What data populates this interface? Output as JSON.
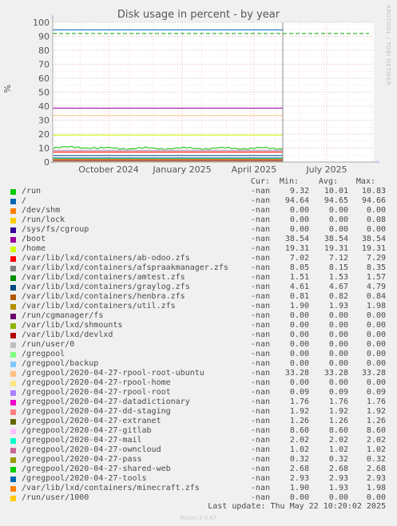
{
  "chart_data": {
    "type": "line",
    "title": "Disk usage in percent - by year",
    "ylabel": "%",
    "ylim": [
      0,
      100
    ],
    "y_ticks": [
      0,
      10,
      20,
      30,
      40,
      50,
      60,
      70,
      80,
      90,
      100
    ],
    "x_ticks": [
      "October 2024",
      "January 2025",
      "April 2025",
      "July 2025"
    ],
    "warning_threshold": 92,
    "grid": true,
    "columns": [
      "Cur:",
      "Min:",
      "Avg:",
      "Max:"
    ],
    "series": [
      {
        "name": "/run",
        "color": "#00cc00",
        "cur": "-nan",
        "min": "9.32",
        "avg": "10.01",
        "max": "10.83"
      },
      {
        "name": "/",
        "color": "#0066b3",
        "cur": "-nan",
        "min": "94.64",
        "avg": "94.65",
        "max": "94.66"
      },
      {
        "name": "/dev/shm",
        "color": "#ff8000",
        "cur": "-nan",
        "min": "0.00",
        "avg": "0.00",
        "max": "0.00"
      },
      {
        "name": "/run/lock",
        "color": "#ffcc00",
        "cur": "-nan",
        "min": "0.00",
        "avg": "0.00",
        "max": "0.08"
      },
      {
        "name": "/sys/fs/cgroup",
        "color": "#330099",
        "cur": "-nan",
        "min": "0.00",
        "avg": "0.00",
        "max": "0.00"
      },
      {
        "name": "/boot",
        "color": "#990099",
        "cur": "-nan",
        "min": "38.54",
        "avg": "38.54",
        "max": "38.54"
      },
      {
        "name": "/home",
        "color": "#ccff00",
        "cur": "-nan",
        "min": "19.31",
        "avg": "19.31",
        "max": "19.31"
      },
      {
        "name": "/var/lib/lxd/containers/ab-odoo.zfs",
        "color": "#ff0000",
        "cur": "-nan",
        "min": "7.02",
        "avg": "7.12",
        "max": "7.29"
      },
      {
        "name": "/var/lib/lxd/containers/afspraakmanager.zfs",
        "color": "#808080",
        "cur": "-nan",
        "min": "8.05",
        "avg": "8.15",
        "max": "8.35"
      },
      {
        "name": "/var/lib/lxd/containers/amtest.zfs",
        "color": "#008f00",
        "cur": "-nan",
        "min": "1.51",
        "avg": "1.53",
        "max": "1.57"
      },
      {
        "name": "/var/lib/lxd/containers/graylog.zfs",
        "color": "#00487d",
        "cur": "-nan",
        "min": "4.61",
        "avg": "4.67",
        "max": "4.79"
      },
      {
        "name": "/var/lib/lxd/containers/henbra.zfs",
        "color": "#b35a00",
        "cur": "-nan",
        "min": "0.81",
        "avg": "0.82",
        "max": "0.84"
      },
      {
        "name": "/var/lib/lxd/containers/util.zfs",
        "color": "#b38f00",
        "cur": "-nan",
        "min": "1.90",
        "avg": "1.93",
        "max": "1.98"
      },
      {
        "name": "/run/cgmanager/fs",
        "color": "#6b006b",
        "cur": "-nan",
        "min": "0.00",
        "avg": "0.00",
        "max": "0.00"
      },
      {
        "name": "/var/lib/lxd/shmounts",
        "color": "#8fb300",
        "cur": "-nan",
        "min": "0.00",
        "avg": "0.00",
        "max": "0.00"
      },
      {
        "name": "/var/lib/lxd/devlxd",
        "color": "#b30000",
        "cur": "-nan",
        "min": "0.00",
        "avg": "0.00",
        "max": "0.00"
      },
      {
        "name": "/run/user/0",
        "color": "#bebebe",
        "cur": "-nan",
        "min": "0.00",
        "avg": "0.00",
        "max": "0.00"
      },
      {
        "name": "/gregpool",
        "color": "#80ff80",
        "cur": "-nan",
        "min": "0.00",
        "avg": "0.00",
        "max": "0.00"
      },
      {
        "name": "/gregpool/backup",
        "color": "#80c9ff",
        "cur": "-nan",
        "min": "0.00",
        "avg": "0.00",
        "max": "0.00"
      },
      {
        "name": "/gregpool/2020-04-27-rpool-root-ubuntu",
        "color": "#ffc080",
        "cur": "-nan",
        "min": "33.28",
        "avg": "33.28",
        "max": "33.28"
      },
      {
        "name": "/gregpool/2020-04-27-rpool-home",
        "color": "#ffe680",
        "cur": "-nan",
        "min": "0.00",
        "avg": "0.00",
        "max": "0.00"
      },
      {
        "name": "/gregpool/2020-04-27-rpool-root",
        "color": "#aa80ff",
        "cur": "-nan",
        "min": "0.09",
        "avg": "0.09",
        "max": "0.09"
      },
      {
        "name": "/gregpool/2020-04-27-datadictionary",
        "color": "#ee00cc",
        "cur": "-nan",
        "min": "1.76",
        "avg": "1.76",
        "max": "1.76"
      },
      {
        "name": "/gregpool/2020-04-27-dd-staging",
        "color": "#ff8080",
        "cur": "-nan",
        "min": "1.92",
        "avg": "1.92",
        "max": "1.92"
      },
      {
        "name": "/gregpool/2020-04-27-extranet",
        "color": "#666600",
        "cur": "-nan",
        "min": "1.26",
        "avg": "1.26",
        "max": "1.26"
      },
      {
        "name": "/gregpool/2020-04-27-gitlab",
        "color": "#ffbfff",
        "cur": "-nan",
        "min": "8.60",
        "avg": "8.60",
        "max": "8.60"
      },
      {
        "name": "/gregpool/2020-04-27-mail",
        "color": "#00ffcc",
        "cur": "-nan",
        "min": "2.02",
        "avg": "2.02",
        "max": "2.02"
      },
      {
        "name": "/gregpool/2020-04-27-owncloud",
        "color": "#cc6699",
        "cur": "-nan",
        "min": "1.02",
        "avg": "1.02",
        "max": "1.02"
      },
      {
        "name": "/gregpool/2020-04-27-pass",
        "color": "#999900",
        "cur": "-nan",
        "min": "0.32",
        "avg": "0.32",
        "max": "0.32"
      },
      {
        "name": "/gregpool/2020-04-27-shared-web",
        "color": "#00cc00",
        "cur": "-nan",
        "min": "2.68",
        "avg": "2.68",
        "max": "2.68"
      },
      {
        "name": "/gregpool/2020-04-27-tools",
        "color": "#0066b3",
        "cur": "-nan",
        "min": "2.93",
        "avg": "2.93",
        "max": "2.93"
      },
      {
        "name": "/var/lib/lxd/containers/minecraft.zfs",
        "color": "#ff8000",
        "cur": "-nan",
        "min": "1.90",
        "avg": "1.93",
        "max": "1.98"
      },
      {
        "name": "/run/user/1000",
        "color": "#ffcc00",
        "cur": "-nan",
        "min": "0.00",
        "avg": "0.00",
        "max": "0.00"
      }
    ]
  },
  "watermark": "RRDTOOL / TOBI OETIKER",
  "footer": {
    "last_update": "Last update: Thu May 22 10:20:02 2025",
    "generator": "Munin 2.0.67"
  }
}
